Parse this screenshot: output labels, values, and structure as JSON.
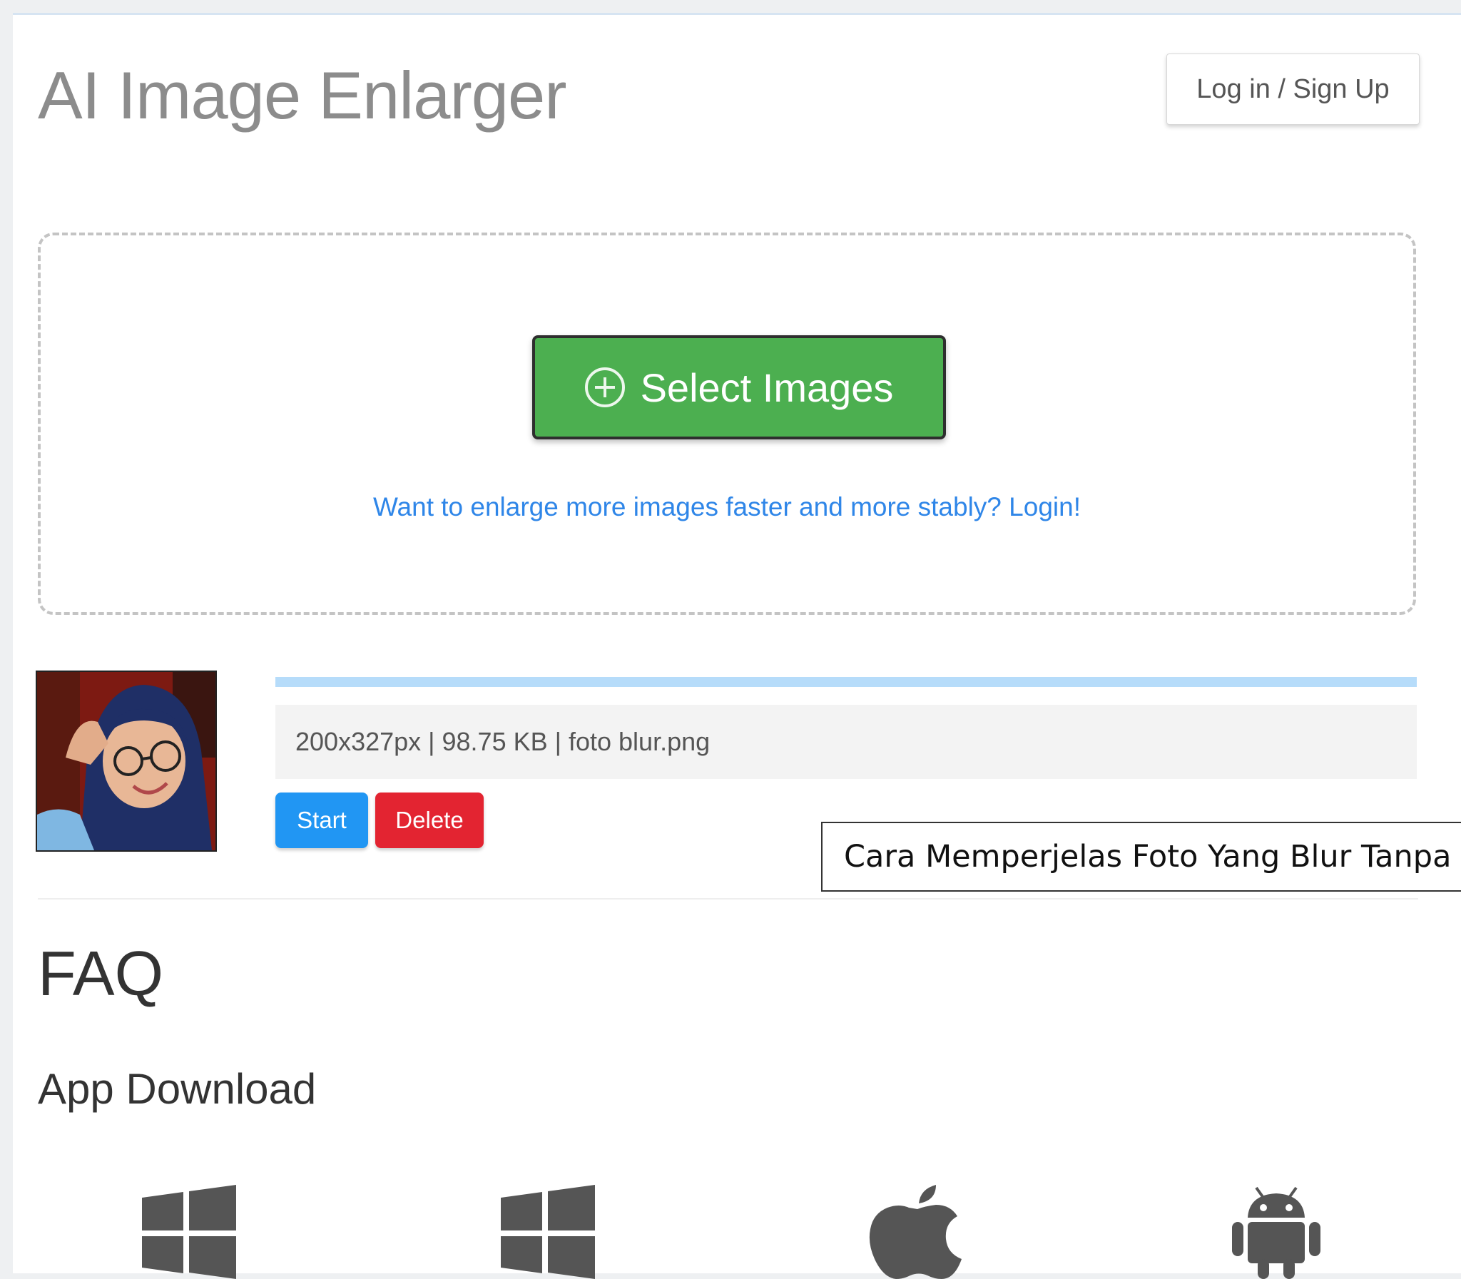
{
  "header": {
    "title": "AI Image Enlarger",
    "login_label": "Log in / Sign Up"
  },
  "upload": {
    "select_label": "Select Images",
    "promo_text": "Want to enlarge more images faster and more stably? Login!"
  },
  "file_item": {
    "info": "200x327px | 98.75 KB | foto blur.png",
    "progress_fraction": 1.0,
    "start_label": "Start",
    "delete_label": "Delete"
  },
  "tooltip": {
    "text": "Cara Memperjelas Foto Yang Blur Tanpa Aplikasi"
  },
  "faq": {
    "title": "FAQ"
  },
  "app_download": {
    "title": "App Download",
    "icons": [
      "windows-icon",
      "windows-icon",
      "apple-icon",
      "android-icon"
    ]
  },
  "colors": {
    "select_button": "#4caf50",
    "start_button": "#2196f3",
    "delete_button": "#e32431",
    "link": "#2f86e8",
    "progress": "#b6dcfa"
  }
}
